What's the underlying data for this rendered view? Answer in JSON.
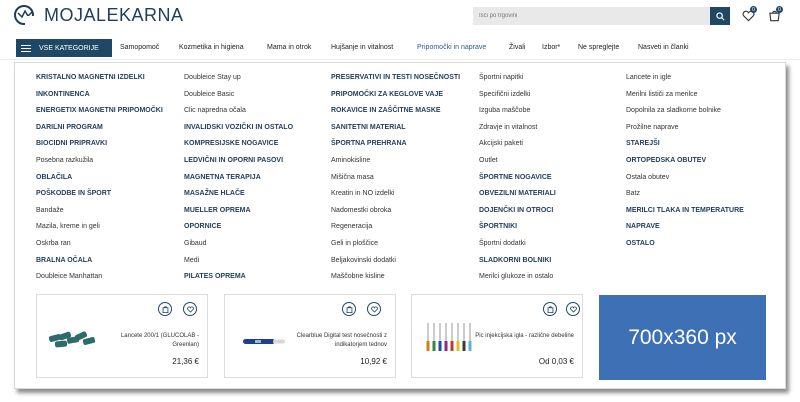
{
  "header": {
    "logo_text": "MOJALEKARNA",
    "search_placeholder": "Išči po trgovini",
    "wishlist_count": "0",
    "cart_count": "0"
  },
  "nav": {
    "all_categories": "VSE KATEGORIJE",
    "items": [
      "Samopomoč",
      "Kozmetika in higiena",
      "Mama in otrok",
      "Hujšanje in vitalnost",
      "Pripomočki in naprave",
      "Živali",
      "Izbor*",
      "Ne spreglejte",
      "Nasveti in članki"
    ]
  },
  "menu": {
    "col1": [
      "KRISTALNO MAGNETNI IZDELKI",
      "INKONTINENCA",
      "ENERGETIX MAGNETNI PRIPOMOČKI",
      "DARILNI PROGRAM",
      "BIOCIDNI PRIPRAVKI",
      "Posebna razkužila",
      "OBLAČILA",
      "POŠKODBE IN ŠPORT",
      "Bandaže",
      "Mazila, kreme in geli",
      "Oskrba ran",
      "BRALNA OČALA",
      "Doubleice Manhattan"
    ],
    "col2": [
      "Doubleice Stay up",
      "Doubleice Basic",
      "Clic napredna očala",
      "INVALIDSKI VOZIČKI IN OSTALO",
      "KOMPRESIJSKE NOGAVICE",
      "LEDVIČNI IN OPORNI PASOVI",
      "MAGNETNA TERAPIJA",
      "MASAŽNE HLAČE",
      "MUELLER OPREMA",
      "OPORNICE",
      "Gibaud",
      "Medi",
      "PILATES OPREMA"
    ],
    "col3": [
      "PRESERVATIVI IN TESTI NOSEČNOSTI",
      "PRIPOMOČKI ZA KEGLOVE VAJE",
      "ROKAVICE IN ZAŠČITNE MASKE",
      "SANITETNI MATERIAL",
      "ŠPORTNA PREHRANA",
      "Aminokisline",
      "Mišična masa",
      "Kreatin in NO izdelki",
      "Nadomestki obroka",
      "Regeneracija",
      "Geli in ploščice",
      "Beljakovinski dodatki",
      "Maščobne kisline"
    ],
    "col4": [
      "Športni napitki",
      "Specifični izdelki",
      "Izguba maščobe",
      "Zdravje in vitalnost",
      "Akcijski paketi",
      "Outlet",
      "ŠPORTNE NOGAVICE",
      "OBVEZILNI MATERIALI",
      "DOJENČKI IN OTROCI",
      "ŠPORTNIKI",
      "Športni dodatki",
      "SLADKORNI BOLNIKI",
      "Merilci glukoze in ostalo"
    ],
    "col5": [
      "Lancete in igle",
      "Merilni lističi za merilce",
      "Dopolnila za sladkorne bolnike",
      "Prožilne naprave",
      "STAREJŠI",
      "ORTOPEDSKA OBUTEV",
      "Ostala obutev",
      "Batz",
      "MERILCI TLAKA IN TEMPERATURE",
      "NAPRAVE",
      "OSTALO"
    ]
  },
  "products": [
    {
      "name": "Lancete 200/1 (GLUCOLAB - Greenlan)",
      "price": "21,36 €"
    },
    {
      "name": "Clearblue Digital test nosečnosti z indikatorjem tednov",
      "price": "10,92 €"
    },
    {
      "name": "Pic injekcijska igla - različne debeline",
      "price": "Od 0,03 €"
    }
  ],
  "banner": {
    "text": "700x360 px",
    "color": "#3d70b5"
  },
  "colors": {
    "brand": "#1f4866",
    "heading": "#1f3d5c"
  }
}
